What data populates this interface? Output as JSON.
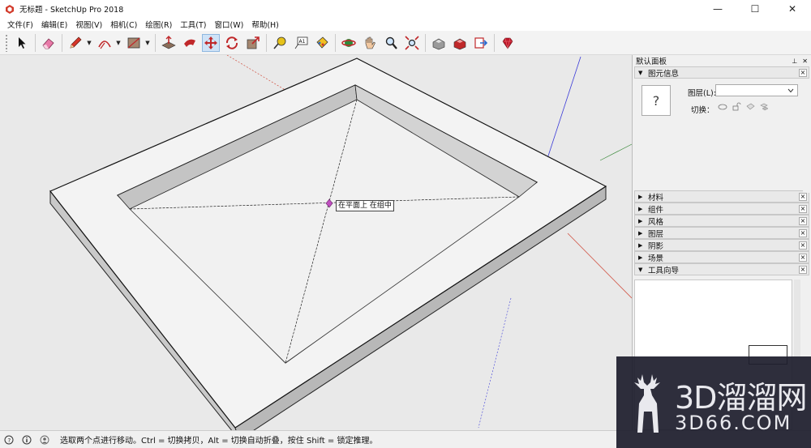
{
  "window": {
    "title": "无标题 - SketchUp Pro 2018",
    "minimize": "—",
    "maximize": "☐",
    "close": "✕"
  },
  "menu": [
    "文件(F)",
    "编辑(E)",
    "视图(V)",
    "相机(C)",
    "绘图(R)",
    "工具(T)",
    "窗口(W)",
    "帮助(H)"
  ],
  "toolbar": {
    "tools": [
      "select-tool",
      "eraser-tool",
      "pencil-line-tool",
      "arc-tool",
      "rectangle-tool",
      "push-pull-tool",
      "follow-me-tool",
      "move-tool",
      "rotate-tool",
      "scale-tool",
      "tape-measure-tool",
      "text-tool",
      "paint-bucket-tool",
      "orbit-tool",
      "pan-tool",
      "zoom-tool",
      "zoom-extents-tool",
      "warehouse-tool",
      "extension-warehouse-tool",
      "send-to-layout-tool",
      "ruby-tool"
    ],
    "active_tool": "move-tool"
  },
  "viewport": {
    "tooltip": "在平面上 在组中"
  },
  "tray": {
    "title": "默认面板",
    "pin": "⊥",
    "close": "✕",
    "entity_info": {
      "title": "图元信息",
      "icon_placeholder": "?",
      "layer_label": "图层(L):",
      "layer_value": "",
      "toggle_label": "切换："
    },
    "panels": [
      {
        "label": "材料",
        "expanded": false
      },
      {
        "label": "组件",
        "expanded": false
      },
      {
        "label": "风格",
        "expanded": false
      },
      {
        "label": "图层",
        "expanded": false
      },
      {
        "label": "阴影",
        "expanded": false
      },
      {
        "label": "场景",
        "expanded": false
      },
      {
        "label": "工具向导",
        "expanded": true
      }
    ]
  },
  "statusbar": {
    "message": "选取两个点进行移动。Ctrl = 切换拷贝，Alt = 切换自动折叠，按住 Shift = 锁定推理。"
  },
  "watermark": {
    "line1": "3D溜溜网",
    "line2": "3D66.COM"
  },
  "colors": {
    "axis_red": "#d05040",
    "axis_green": "#3d8a3d",
    "axis_blue": "#3b3bd8",
    "model_face": "#f3f3f3",
    "model_side": "#c9c9c9",
    "inference_point": "#c050c0"
  }
}
